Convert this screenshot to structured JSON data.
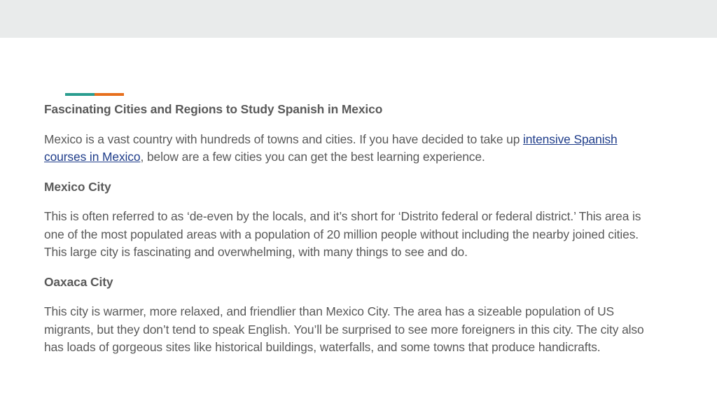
{
  "article": {
    "title": "Fascinating Cities and Regions to Study Spanish in Mexico",
    "intro_before": "Mexico is a vast country with hundreds of towns and cities. If you have decided to take up ",
    "intro_link": "intensive Spanish courses in Mexico",
    "intro_after": ", below are a few cities you can get the best learning experience.",
    "sections": [
      {
        "heading": "Mexico City",
        "body": "This is often referred to as ‘de-even by the locals, and it’s short for ‘Distrito federal or federal district.’ This area is one of the most populated areas with a population of 20 million people without including the nearby joined cities. This large city is fascinating and overwhelming, with many things to see and do."
      },
      {
        "heading": "Oaxaca City",
        "body": "This city is warmer, more relaxed, and friendlier than Mexico City. The area has a sizeable population of US migrants, but they don’t tend to speak English. You’ll be surprised to see more foreigners in this city. The city also has loads of gorgeous sites like historical buildings, waterfalls, and some towns that produce handicrafts."
      }
    ]
  },
  "colors": {
    "accent_teal": "#2a9d8f",
    "accent_orange": "#e76f1d",
    "text": "#595959",
    "link": "#1f3d8a",
    "topbar": "#e9ebeb"
  }
}
